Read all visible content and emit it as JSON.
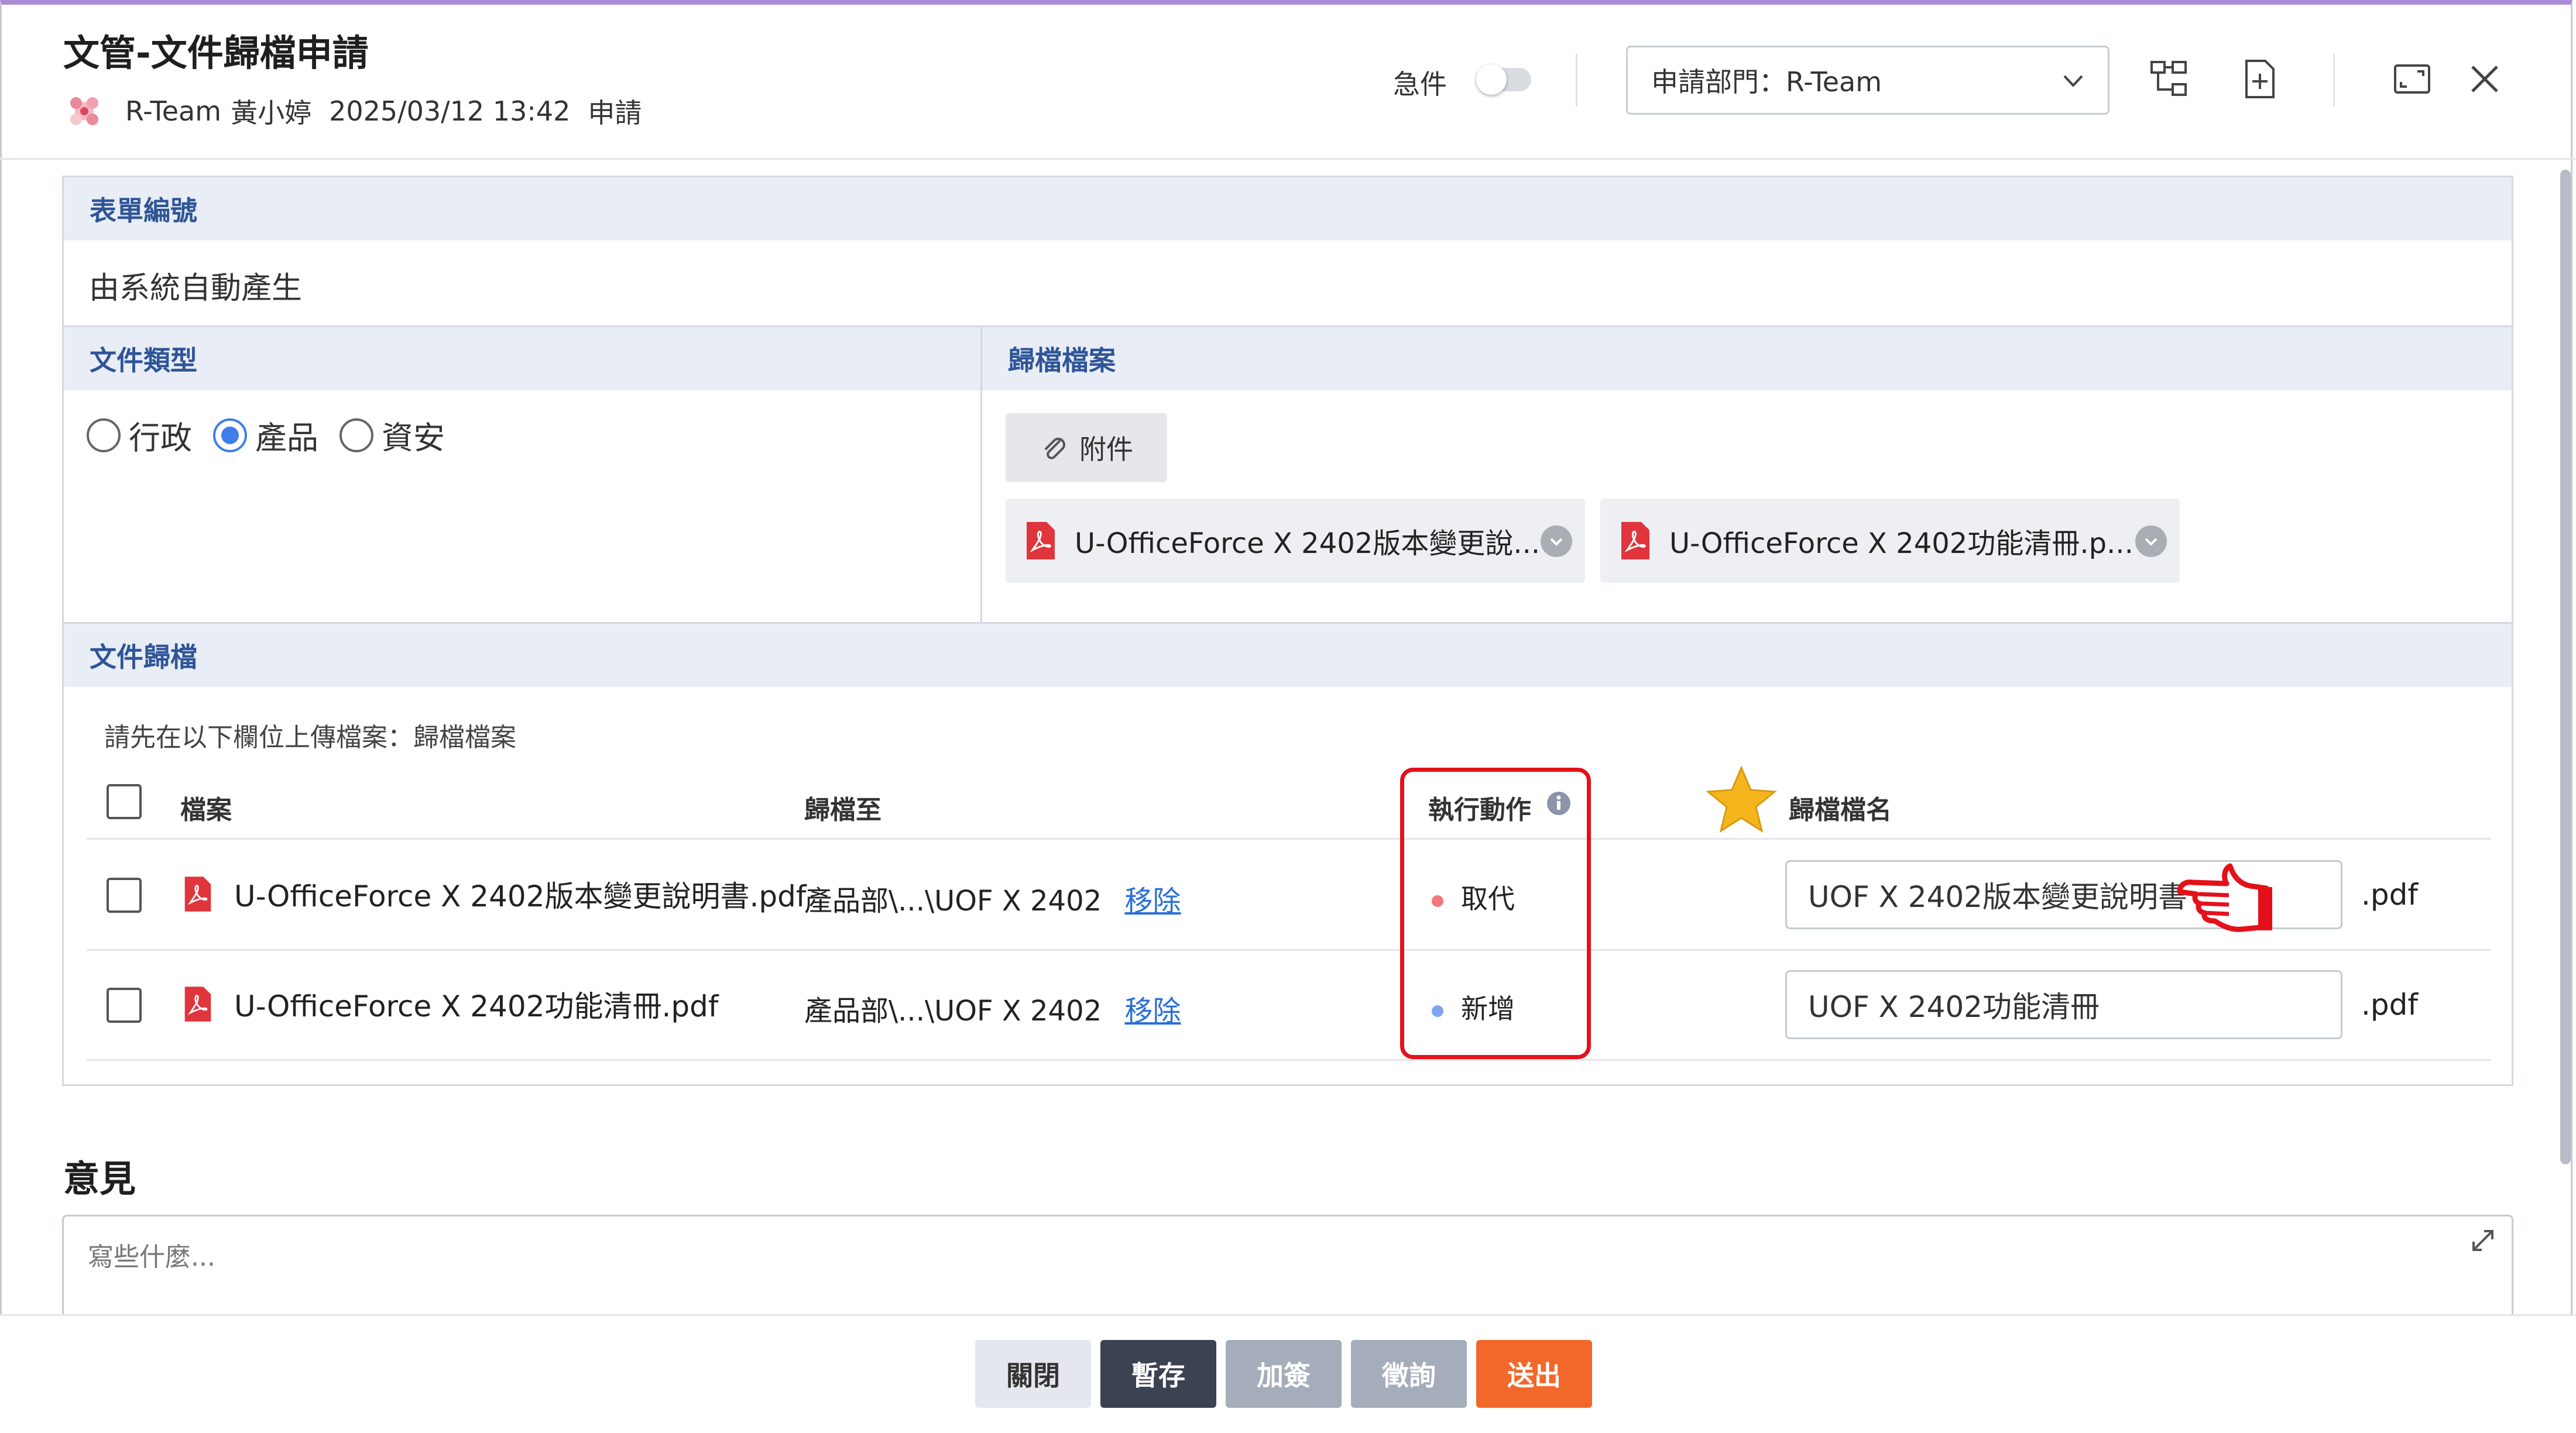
{
  "header": {
    "title": "文管-文件歸檔申請",
    "team": "R-Team",
    "user": "黃小婷",
    "datetime": "2025/03/12 13:42",
    "action": "申請",
    "urgent_label": "急件",
    "dept_select": "申請部門：R-Team"
  },
  "form": {
    "form_no_label": "表單編號",
    "form_no_value": "由系統自動產生",
    "doc_type_label": "文件類型",
    "doc_types": [
      "行政",
      "產品",
      "資安"
    ],
    "doc_type_selected": "產品",
    "archive_files_label": "歸檔檔案",
    "attach_button": "附件",
    "attached_files": [
      "U-OfficeForce X 2402版本變更說...",
      "U-OfficeForce X 2402功能清冊.p..."
    ],
    "doc_archive_label": "文件歸檔",
    "hint": "請先在以下欄位上傳檔案：歸檔檔案",
    "table": {
      "headers": [
        "檔案",
        "歸檔至",
        "執行動作",
        "歸檔檔名"
      ],
      "rows": [
        {
          "file": "U-OfficeForce X 2402版本變更說明書.pdf",
          "dest": "產品部\\...\\UOF X 2402",
          "remove": "移除",
          "action": "取代",
          "action_color": "#f07a7a",
          "name": "UOF X 2402版本變更說明書",
          "ext": ".pdf"
        },
        {
          "file": "U-OfficeForce X 2402功能清冊.pdf",
          "dest": "產品部\\...\\UOF X 2402",
          "remove": "移除",
          "action": "新增",
          "action_color": "#7ea6ee",
          "name": "UOF X  2402功能清冊",
          "ext": ".pdf"
        }
      ]
    }
  },
  "opinion": {
    "title": "意見",
    "placeholder": "寫些什麼..."
  },
  "footer": {
    "close": "關閉",
    "save": "暫存",
    "add_sign": "加簽",
    "consult": "徵詢",
    "submit": "送出"
  },
  "colors": {
    "accent_orange": "#f2682a",
    "dark_button": "#3b4252",
    "highlight_red": "#e4111b",
    "section_blue": "#2f5597"
  }
}
